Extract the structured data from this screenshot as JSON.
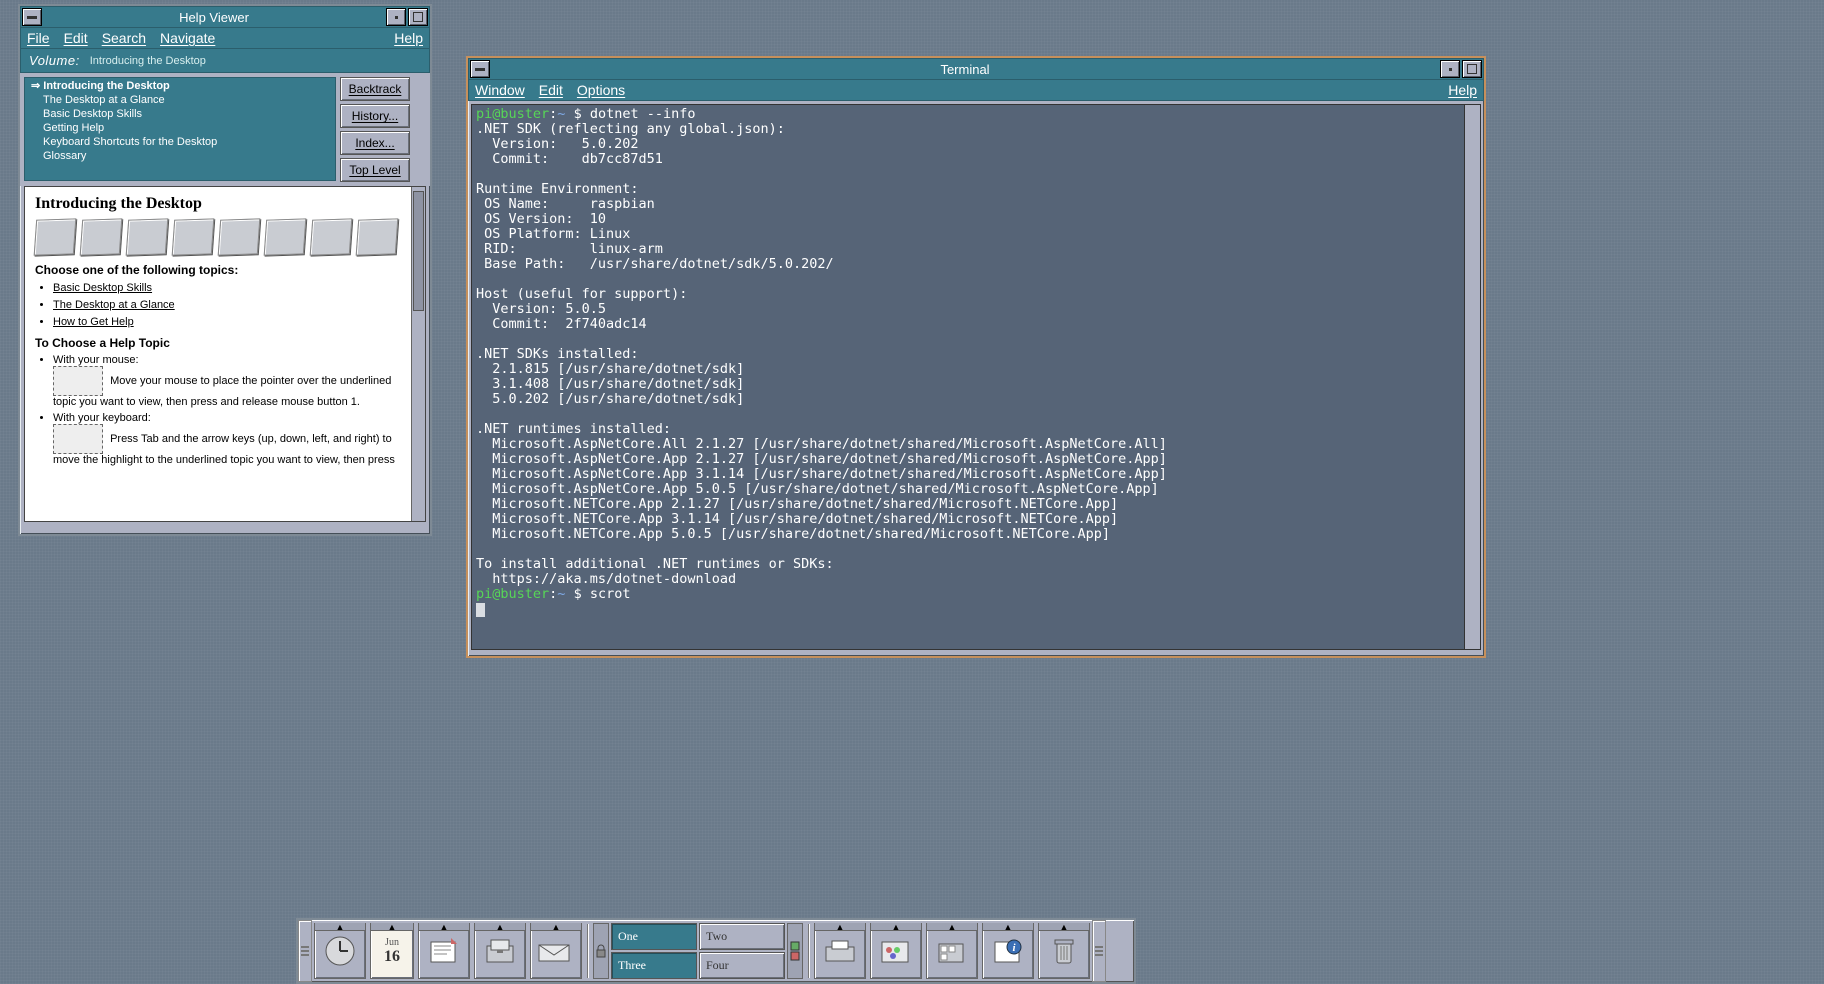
{
  "helpviewer": {
    "title": "Help Viewer",
    "menus": [
      "File",
      "Edit",
      "Search",
      "Navigate"
    ],
    "help_menu": "Help",
    "volume_label": "Volume:",
    "volume_value": "Introducing the Desktop",
    "nav": {
      "root": "Introducing the Desktop",
      "items": [
        "The Desktop at a Glance",
        "Basic Desktop Skills",
        "Getting Help",
        "Keyboard Shortcuts for the Desktop",
        "Glossary"
      ]
    },
    "buttons": {
      "backtrack": "Backtrack",
      "history": "History...",
      "index": "Index...",
      "toplevel": "Top Level"
    },
    "doc": {
      "heading": "Introducing the Desktop",
      "choose": "Choose one of the following topics:",
      "links": [
        "Basic Desktop Skills",
        "The Desktop at a Glance",
        "How to Get Help"
      ],
      "topic_heading": "To Choose a Help Topic",
      "mouse_label": "With your mouse:",
      "mouse_text": "Move your mouse to place the pointer over the underlined topic you want to view, then press and release mouse button 1.",
      "keyboard_label": "With your keyboard:",
      "keyboard_text": "Press Tab and the arrow keys (up, down, left, and right) to move the highlight to the underlined topic you want to view, then press"
    }
  },
  "terminal": {
    "title": "Terminal",
    "menus": [
      "Window",
      "Edit",
      "Options"
    ],
    "help_menu": "Help",
    "prompt": {
      "userhost": "pi@buster",
      "path": "~",
      "sep": ":",
      "sigil": "$"
    },
    "cmd1": "dotnet --info",
    "cmd2": "scrot",
    "output": ".NET SDK (reflecting any global.json):\n  Version:   5.0.202\n  Commit:    db7cc87d51\n\nRuntime Environment:\n OS Name:     raspbian\n OS Version:  10\n OS Platform: Linux\n RID:         linux-arm\n Base Path:   /usr/share/dotnet/sdk/5.0.202/\n\nHost (useful for support):\n  Version: 5.0.5\n  Commit:  2f740adc14\n\n.NET SDKs installed:\n  2.1.815 [/usr/share/dotnet/sdk]\n  3.1.408 [/usr/share/dotnet/sdk]\n  5.0.202 [/usr/share/dotnet/sdk]\n\n.NET runtimes installed:\n  Microsoft.AspNetCore.All 2.1.27 [/usr/share/dotnet/shared/Microsoft.AspNetCore.All]\n  Microsoft.AspNetCore.App 2.1.27 [/usr/share/dotnet/shared/Microsoft.AspNetCore.App]\n  Microsoft.AspNetCore.App 3.1.14 [/usr/share/dotnet/shared/Microsoft.AspNetCore.App]\n  Microsoft.AspNetCore.App 5.0.5 [/usr/share/dotnet/shared/Microsoft.AspNetCore.App]\n  Microsoft.NETCore.App 2.1.27 [/usr/share/dotnet/shared/Microsoft.NETCore.App]\n  Microsoft.NETCore.App 3.1.14 [/usr/share/dotnet/shared/Microsoft.NETCore.App]\n  Microsoft.NETCore.App 5.0.5 [/usr/share/dotnet/shared/Microsoft.NETCore.App]\n\nTo install additional .NET runtimes or SDKs:\n  https://aka.ms/dotnet-download"
  },
  "panel": {
    "date": {
      "month": "Jun",
      "day": "16"
    },
    "workspaces": {
      "one": "One",
      "two": "Two",
      "three": "Three",
      "four": "Four"
    }
  }
}
